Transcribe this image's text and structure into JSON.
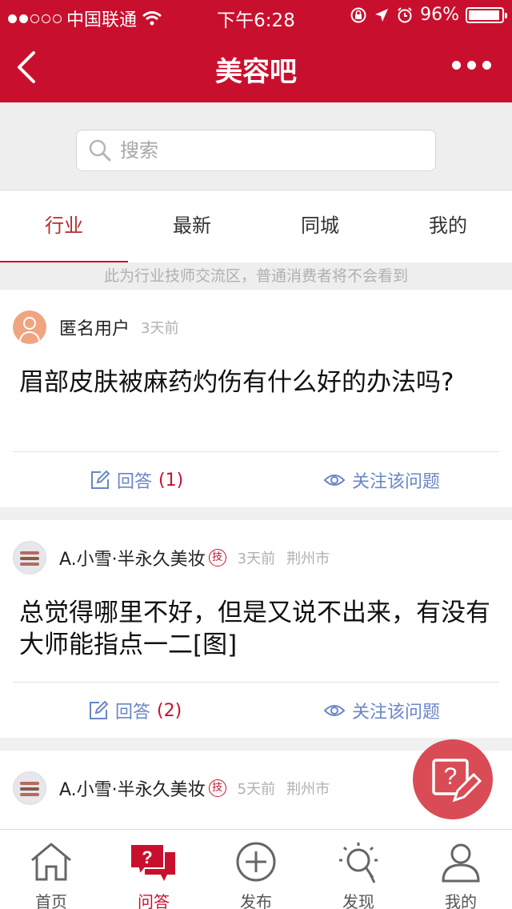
{
  "status_bar": {
    "carrier": "中国联通",
    "time": "下午6:28",
    "battery": "96%",
    "battery_level": 0.96
  },
  "nav": {
    "title": "美容吧"
  },
  "search": {
    "placeholder": "搜索"
  },
  "tabs": [
    {
      "label": "行业",
      "active": true
    },
    {
      "label": "最新",
      "active": false
    },
    {
      "label": "同城",
      "active": false
    },
    {
      "label": "我的",
      "active": false
    }
  ],
  "notice": "此为行业技师交流区，普通消费者将不会看到",
  "posts": [
    {
      "author": "匿名用户",
      "time": "3天前",
      "location": "",
      "badge": "",
      "question": "眉部皮肤被麻药灼伤有什么好的办法吗?",
      "answer_label": "回答",
      "answer_count": "(1)",
      "follow_label": "关注该问题"
    },
    {
      "author": "A.小雪·半永久美妆",
      "time": "3天前",
      "location": "荆州市",
      "badge": "技",
      "question": "总觉得哪里不好，但是又说不出来，有没有大师能指点一二[图]",
      "answer_label": "回答",
      "answer_count": "(2)",
      "follow_label": "关注该问题"
    },
    {
      "author": "A.小雪·半永久美妆",
      "time": "5天前",
      "location": "荆州市",
      "badge": "技"
    }
  ],
  "tabbar": [
    {
      "label": "首页",
      "icon": "home-icon",
      "active": false
    },
    {
      "label": "问答",
      "icon": "qa-icon",
      "active": true
    },
    {
      "label": "发布",
      "icon": "add-circle-icon",
      "active": false
    },
    {
      "label": "发现",
      "icon": "lightbulb-icon",
      "active": false
    },
    {
      "label": "我的",
      "icon": "user-icon",
      "active": false
    }
  ],
  "colors": {
    "brand": "#c8102e",
    "link": "#6a86c6",
    "muted": "#b0b0b0",
    "fab": "#d94b55"
  }
}
